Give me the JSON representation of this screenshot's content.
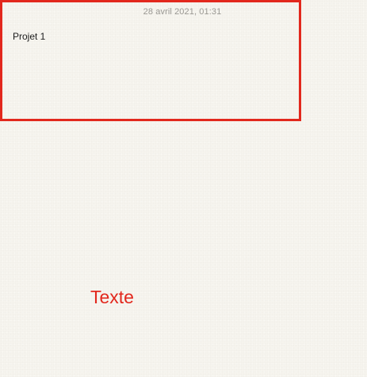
{
  "note": {
    "timestamp": "28 avril 2021, 01:31",
    "body_line_1": "Projet 1"
  },
  "annotation": {
    "label": "Texte",
    "color": "#e2281d"
  }
}
